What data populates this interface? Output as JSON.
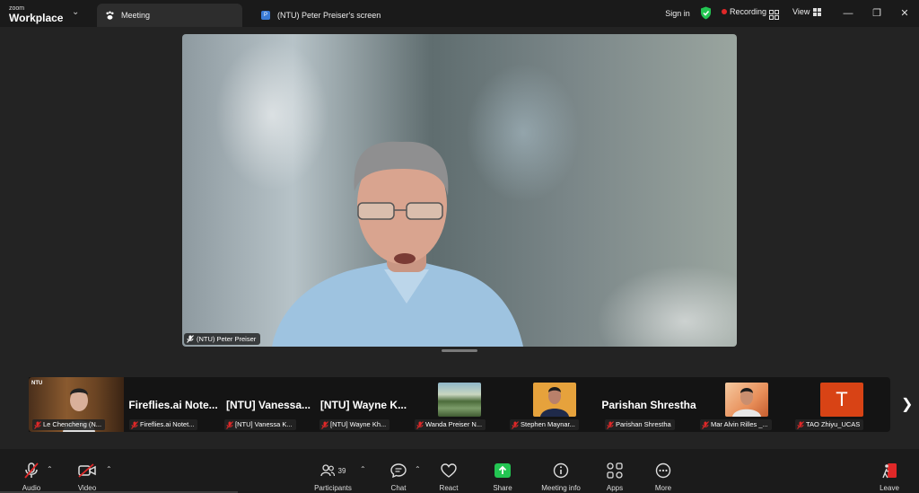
{
  "app": {
    "brand_small": "zoom",
    "brand_big": "Workplace"
  },
  "tabs": [
    {
      "label": "Meeting",
      "icon": "paw-icon"
    },
    {
      "label": "(NTU) Peter Preiser's screen",
      "icon": "screen-share-icon"
    }
  ],
  "titlebar": {
    "sign_in": "Sign in",
    "recording": "Recording",
    "view": "View"
  },
  "main_video": {
    "speaker_name": "(NTU) Peter Preiser"
  },
  "participants_strip": [
    {
      "caption": "Le Chencheng  (N...",
      "big_name": "",
      "type": "video",
      "thumb_label": "NTU"
    },
    {
      "caption": "Fireflies.ai Notet...",
      "big_name": "Fireflies.ai  Note...",
      "type": "name"
    },
    {
      "caption": "[NTU] Vanessa K...",
      "big_name": "[NTU]  Vanessa...",
      "type": "name"
    },
    {
      "caption": "[NTU] Wayne Kh...",
      "big_name": "[NTU]  Wayne  K...",
      "type": "name"
    },
    {
      "caption": "Wanda Preiser N...",
      "big_name": "",
      "type": "photo"
    },
    {
      "caption": "Stephen Maynar...",
      "big_name": "",
      "type": "photo"
    },
    {
      "caption": "Parishan Shrestha",
      "big_name": "Parishan  Shrestha",
      "type": "name"
    },
    {
      "caption": "Mar Alvin Rilles _...",
      "big_name": "",
      "type": "photo"
    },
    {
      "caption": "TAO Zhiyu_UCAS",
      "big_name": "",
      "type": "avatar",
      "avatar_letter": "T"
    }
  ],
  "toolbar": {
    "audio": "Audio",
    "video": "Video",
    "participants": "Participants",
    "participants_count": "39",
    "chat": "Chat",
    "react": "React",
    "share": "Share",
    "meeting_info": "Meeting info",
    "apps": "Apps",
    "more": "More",
    "leave": "Leave"
  },
  "colors": {
    "recording_dot": "#e02828",
    "shield": "#23c552",
    "share_green": "#23c552",
    "muted_red": "#e02828",
    "avatar_orange": "#d84315"
  }
}
